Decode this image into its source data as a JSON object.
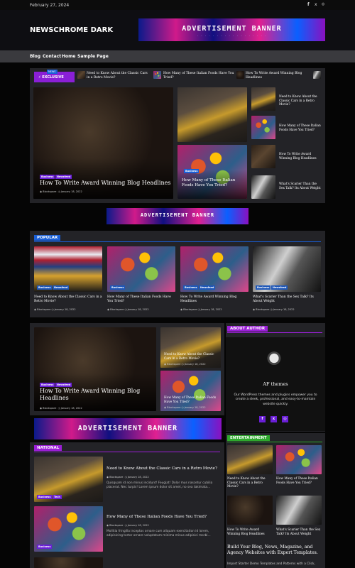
{
  "topbar": {
    "date": "February 27, 2024",
    "social": [
      "f",
      "x",
      "ig"
    ]
  },
  "header": {
    "site_title": "NEWSCHROME DARK",
    "ad_banner": "ADVERTISEMENT BANNER"
  },
  "nav": {
    "items": [
      "Blog",
      "Contact",
      "Home",
      "Sample Page"
    ]
  },
  "ticker": {
    "new": "NEWS",
    "label": "EXCLUSIVE",
    "items": [
      "Need to Know About the Classic Cars in a Retro Movie?",
      "How Many of These Italian Foods Have You Tried?",
      "How To Write Award Winning Blog Headlines"
    ]
  },
  "hero": {
    "main": {
      "cats": [
        "Business",
        "Newsfeed"
      ],
      "title": "How To Write Award Winning Blog Headlines",
      "author": "Blockspare",
      "date": "January 18, 2022"
    },
    "side_small": [
      {
        "title": "Need to Know About the Classic Cars in a Retro Movie?"
      },
      {
        "title": "How Many of These Italian Foods Have You Tried?"
      },
      {
        "title": "How To Write Award Winning Blog Headlines"
      },
      {
        "title": "What's Scarier Than the Sex Talk? Its About Weight"
      }
    ],
    "food_card": {
      "cats": [
        "Business"
      ],
      "title": "How Many of These Italian Foods Have You Tried?"
    }
  },
  "ad2": "ADVERTISEMENT BANNER",
  "popular": {
    "heading": "POPULAR",
    "items": [
      {
        "cats": [
          "Business",
          "Newsfeed"
        ],
        "title": "Need to Know About the Classic Cars in a Retro Movie?",
        "author": "Blockspare",
        "date": "January 18, 2022"
      },
      {
        "cats": [
          "Business"
        ],
        "title": "How Many of These Italian Foods Have You Tried?",
        "author": "Blockspare",
        "date": "January 18, 2022"
      },
      {
        "cats": [
          "Business",
          "Newsfeed"
        ],
        "title": "How To Write Award Winning Blog Headlines",
        "author": "Blockspare",
        "date": "January 18, 2022"
      },
      {
        "cats": [
          "Business",
          "Newsfeed"
        ],
        "title": "What's Scarier Than the Sex Talk? Its About Weight",
        "author": "Blockspare",
        "date": "January 18, 2022"
      }
    ]
  },
  "feature": {
    "main": {
      "cats": [
        "Business",
        "Newsfeed"
      ],
      "title": "How To Write Award Winning Blog Headlines",
      "author": "Blockspare",
      "date": "January 18, 2022"
    },
    "side": [
      {
        "title": "Need to Know About the Classic Cars in a Retro Movie?",
        "author": "Blockspare",
        "date": "January 18, 2022"
      },
      {
        "title": "How Many of These Italian Foods Have You Tried?",
        "author": "Blockspare",
        "date": "January 18, 2022"
      }
    ]
  },
  "ad3": "ADVERTISEMENT BANNER",
  "national": {
    "heading": "NATIONAL",
    "items": [
      {
        "cats": [
          "Business",
          "Tech"
        ],
        "title": "Need to Know About the Classic Cars in a Retro Movie?",
        "author": "Blockspare",
        "date": "January 18, 2022",
        "excerpt": "Quisquam id non minus incidunt! Feugiat! Dolor mus nascetur cubilia placerat. Nec turpis! Lorem ipsum dolor sit amet, no sea takimata..."
      },
      {
        "cats": [
          "Business"
        ],
        "title": "How Many of These Italian Foods Have You Tried?",
        "author": "Blockspare",
        "date": "January 18, 2022",
        "excerpt": "Mollitia fringilla inceptos ornare cum aliquam exercitation id lorem, adipisicing tortor ornare voluptatum minima minus adipisici morbi..."
      }
    ]
  },
  "about": {
    "heading": "ABOUT AUTHOR",
    "name": "AF themes",
    "text": "Our WordPress themes and plugins empower you to create a sleek, professional, and easy-to-maintain website quickly.",
    "social": [
      "f",
      "x",
      "ig"
    ]
  },
  "entertainment": {
    "heading": "ENTERTAINMENT",
    "items": [
      {
        "title": "Need to Know About the Classic Cars in a Retro Movie?"
      },
      {
        "title": "How Many of These Italian Foods Have You Tried?"
      },
      {
        "title": "How To Write Award Winning Blog Headlines"
      },
      {
        "title": "What's Scarier Than the Sex Talk? Its About Weight"
      }
    ]
  },
  "promo": {
    "title": "Build Your Blog, News, Magazine, and Agency Websites with Expert Templates.",
    "text": "Import Starter Demo Templates and Patterns with a Click,"
  },
  "colors": {
    "accent": "#6a1fd6",
    "popular": "#1a5fd6",
    "entertainment": "#2ea82e",
    "about": "#9b1fd6"
  }
}
